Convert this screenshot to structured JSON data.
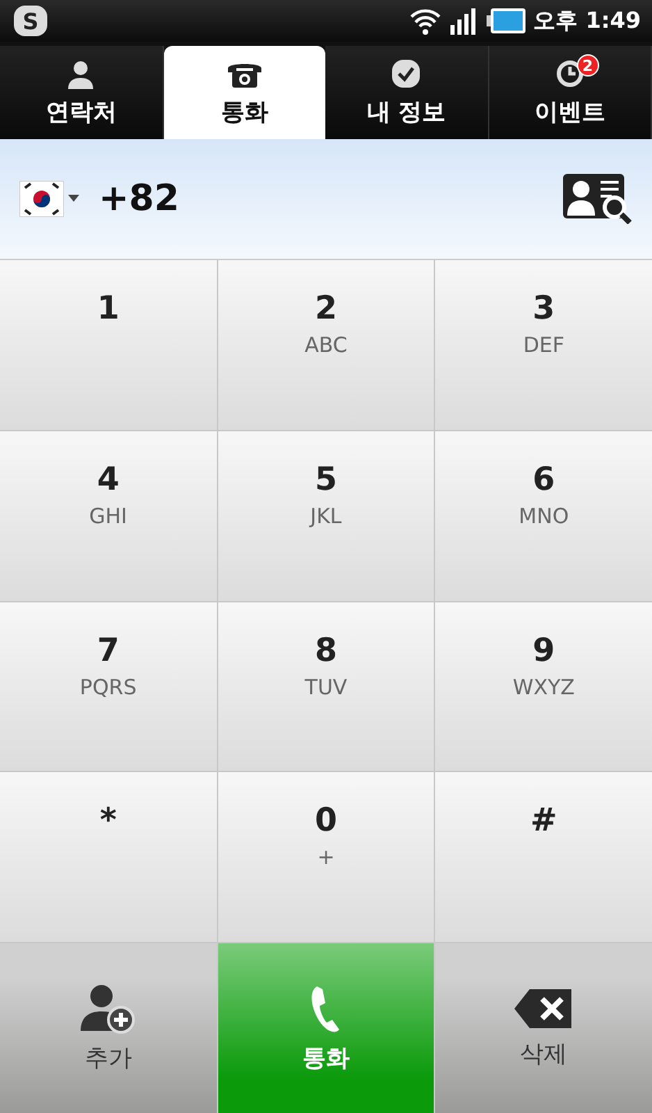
{
  "status_bar": {
    "app_badge": "S",
    "time": "오후 1:49"
  },
  "tabs": [
    {
      "label": "연락처",
      "kind": "contacts",
      "selected": false
    },
    {
      "label": "통화",
      "kind": "phone",
      "selected": true
    },
    {
      "label": "내 정보",
      "kind": "profile",
      "selected": false
    },
    {
      "label": "이벤트",
      "kind": "events",
      "selected": false,
      "badge": "2"
    }
  ],
  "dial_field": {
    "value": "+82"
  },
  "keys": [
    {
      "digit": "1"
    },
    {
      "digit": "2",
      "letters": "ABC"
    },
    {
      "digit": "3",
      "letters": "DEF"
    },
    {
      "digit": "4",
      "letters": "GHI"
    },
    {
      "digit": "5",
      "letters": "JKL"
    },
    {
      "digit": "6",
      "letters": "MNO"
    },
    {
      "digit": "7",
      "letters": "PQRS"
    },
    {
      "digit": "8",
      "letters": "TUV"
    },
    {
      "digit": "9",
      "letters": "WXYZ"
    },
    {
      "digit": "*"
    },
    {
      "digit": "0",
      "letters": "+"
    },
    {
      "digit": "#"
    }
  ],
  "actions": [
    {
      "label": "추가",
      "kind": "add"
    },
    {
      "label": "통화",
      "kind": "call"
    },
    {
      "label": "삭제",
      "kind": "delete"
    }
  ]
}
